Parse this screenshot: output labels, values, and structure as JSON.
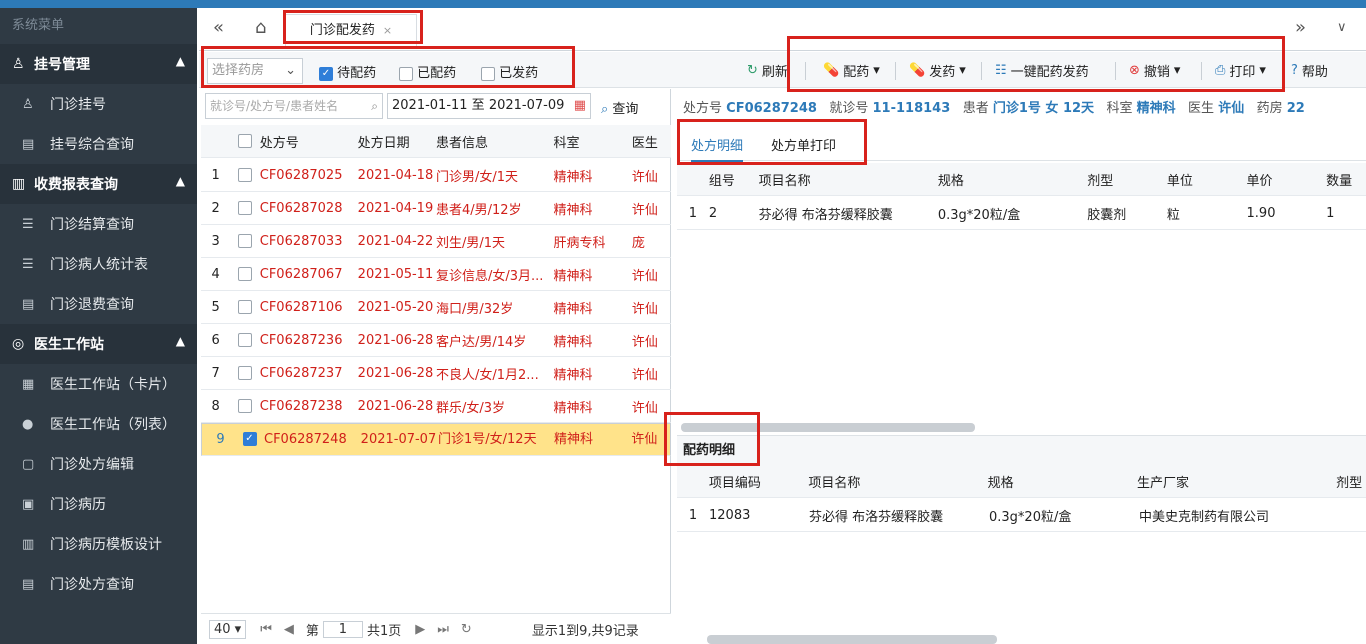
{
  "sidebar": {
    "title": "系统菜单",
    "groups": [
      {
        "label": "挂号管理",
        "icon": "user-icon",
        "items": [
          "门诊挂号",
          "挂号综合查询"
        ]
      },
      {
        "label": "收费报表查询",
        "icon": "book-icon",
        "items": [
          "门诊结算查询",
          "门诊病人统计表",
          "门诊退费查询"
        ]
      },
      {
        "label": "医生工作站",
        "icon": "location-icon",
        "items": [
          "医生工作站（卡片）",
          "医生工作站（列表）",
          "门诊处方编辑",
          "门诊病历",
          "门诊病历模板设计",
          "门诊处方查询"
        ]
      }
    ]
  },
  "tabbar": {
    "tab_label": "门诊配发药",
    "close": "×"
  },
  "toolbar": {
    "pharmacy_placeholder": "选择药房",
    "filters": [
      {
        "label": "待配药",
        "checked": true
      },
      {
        "label": "已配药",
        "checked": false
      },
      {
        "label": "已发药",
        "checked": false
      }
    ],
    "refresh": "刷新",
    "dispense": "配药",
    "issue": "发药",
    "one_key": "一键配药发药",
    "undo": "撤销",
    "print": "打印",
    "help": "帮助"
  },
  "left": {
    "search_placeholder": "就诊号/处方号/患者姓名",
    "date_range": "2021-01-11 至 2021-07-09",
    "query": "查询",
    "columns": [
      "处方号",
      "处方日期",
      "患者信息",
      "科室",
      "医生"
    ],
    "rows": [
      {
        "no": "1",
        "rx": "CF06287025",
        "date": "2021-04-18",
        "patient": "门诊男/女/1天",
        "dept": "精神科",
        "doctor": "许仙"
      },
      {
        "no": "2",
        "rx": "CF06287028",
        "date": "2021-04-19",
        "patient": "患者4/男/12岁",
        "dept": "精神科",
        "doctor": "许仙"
      },
      {
        "no": "3",
        "rx": "CF06287033",
        "date": "2021-04-22",
        "patient": "刘生/男/1天",
        "dept": "肝病专科",
        "doctor": "庞"
      },
      {
        "no": "4",
        "rx": "CF06287067",
        "date": "2021-05-11",
        "patient": "复诊信息/女/3月...",
        "dept": "精神科",
        "doctor": "许仙"
      },
      {
        "no": "5",
        "rx": "CF06287106",
        "date": "2021-05-20",
        "patient": "海口/男/32岁",
        "dept": "精神科",
        "doctor": "许仙"
      },
      {
        "no": "6",
        "rx": "CF06287236",
        "date": "2021-06-28",
        "patient": "客户达/男/14岁",
        "dept": "精神科",
        "doctor": "许仙"
      },
      {
        "no": "7",
        "rx": "CF06287237",
        "date": "2021-06-28",
        "patient": "不良人/女/1月2...",
        "dept": "精神科",
        "doctor": "许仙"
      },
      {
        "no": "8",
        "rx": "CF06287238",
        "date": "2021-06-28",
        "patient": "群乐/女/3岁",
        "dept": "精神科",
        "doctor": "许仙"
      },
      {
        "no": "9",
        "rx": "CF06287248",
        "date": "2021-07-07",
        "patient": "门诊1号/女/12天",
        "dept": "精神科",
        "doctor": "许仙"
      }
    ],
    "pager": {
      "page_size": "40",
      "page_label": "第",
      "page": "1",
      "total_pages": "共1页",
      "summary": "显示1到9,共9记录"
    }
  },
  "right": {
    "info": {
      "rx_label": "处方号",
      "rx": "CF06287248",
      "visit_label": "就诊号",
      "visit": "11-118143",
      "patient_label": "患者",
      "patient": "门诊1号 女 12天",
      "dept_label": "科室",
      "dept": "精神科",
      "doctor_label": "医生",
      "doctor": "许仙",
      "pharmacy_label": "药房",
      "pharmacy": "22"
    },
    "subtabs": [
      "处方明细",
      "处方单打印"
    ],
    "detail_columns": [
      "组号",
      "项目名称",
      "规格",
      "剂型",
      "单位",
      "单价",
      "数量"
    ],
    "detail_rows": [
      {
        "no": "1",
        "group": "2",
        "name": "芬必得 布洛芬缓释胶囊",
        "spec": "0.3g*20粒/盒",
        "form": "胶囊剂",
        "unit": "粒",
        "price": "1.90",
        "qty": "1"
      }
    ],
    "dispense_title": "配药明细",
    "dispense_columns": [
      "项目编码",
      "项目名称",
      "规格",
      "生产厂家",
      "剂型"
    ],
    "dispense_rows": [
      {
        "no": "1",
        "code": "12083",
        "name": "芬必得 布洛芬缓释胶囊",
        "spec": "0.3g*20粒/盒",
        "maker": "中美史克制药有限公司"
      }
    ]
  }
}
